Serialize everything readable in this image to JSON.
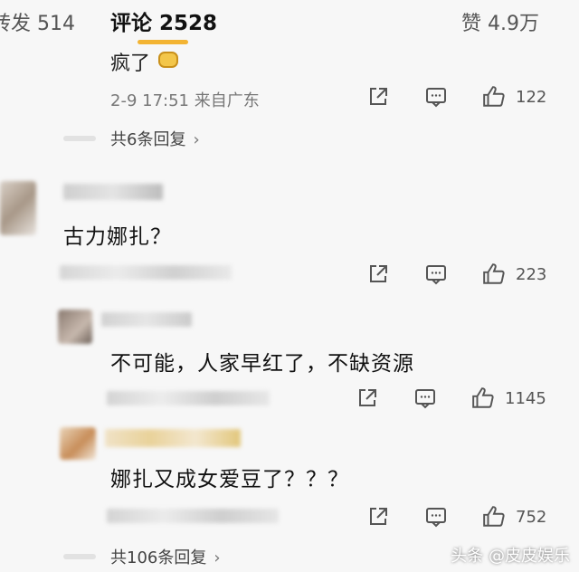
{
  "tabs": {
    "repost_label": "转发 514",
    "comments_label": "评论 2528",
    "likes_label": "赞 4.9万",
    "accent_color": "#f3b433"
  },
  "prev_comment": {
    "text_tail": "疯了",
    "timestamp": "2-9 17:51 来自广东",
    "like_count": "122",
    "replies_label": "共6条回复"
  },
  "comments": [
    {
      "text": "古力娜扎？",
      "like_count": "223"
    },
    {
      "text": "不可能，人家早红了，不缺资源",
      "like_count": "1145"
    },
    {
      "text": "娜扎又成女爱豆了？？？",
      "like_count": "752",
      "replies_label": "共106条回复"
    }
  ],
  "icons": {
    "share": "share-icon",
    "comment": "comment-icon",
    "like": "thumbs-up-icon",
    "chevron": "chevron-right-icon"
  },
  "watermark": "头条 @皮皮娱乐"
}
